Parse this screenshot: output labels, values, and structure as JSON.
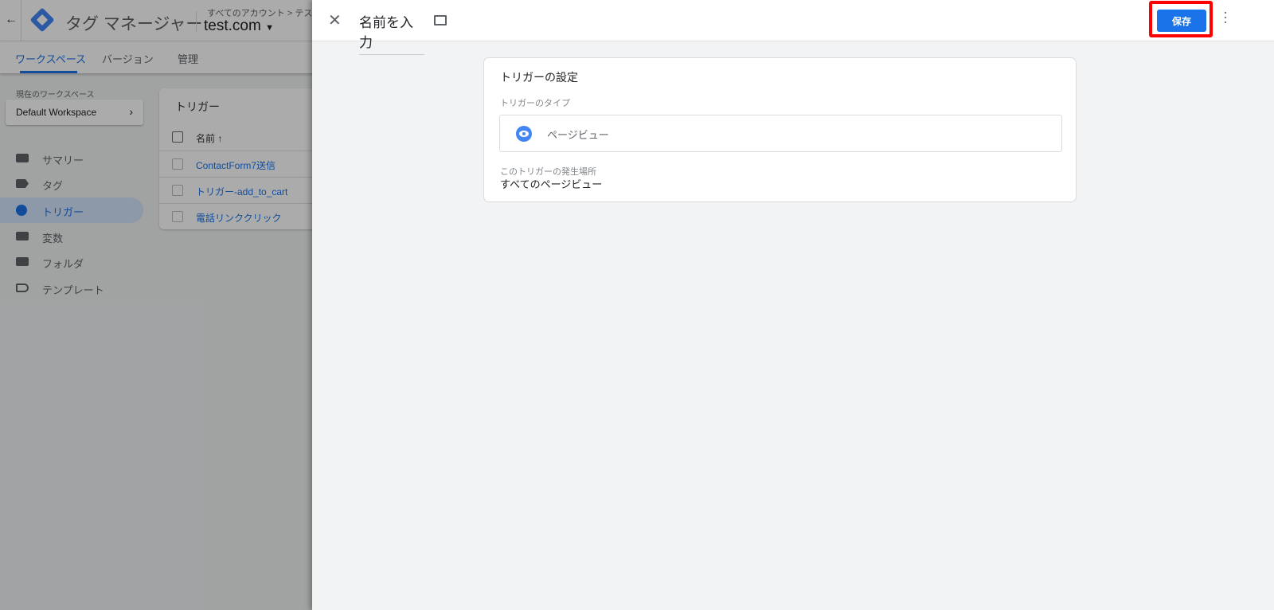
{
  "background": {
    "app_title": "タグ マネージャー",
    "breadcrumb": "すべてのアカウント > テスト",
    "account": "test.com",
    "tabs": [
      "ワークスペース",
      "バージョン",
      "管理"
    ],
    "workspace_label": "現在のワークスペース",
    "workspace": "Default Workspace",
    "nav": [
      {
        "label": "サマリー",
        "icon": "briefcase-icon"
      },
      {
        "label": "タグ",
        "icon": "tag-icon"
      },
      {
        "label": "トリガー",
        "icon": "trigger-icon",
        "active": true
      },
      {
        "label": "変数",
        "icon": "variables-icon"
      },
      {
        "label": "フォルダ",
        "icon": "folder-icon"
      },
      {
        "label": "テンプレート",
        "icon": "template-icon"
      }
    ],
    "list": {
      "title": "トリガー",
      "column": "名前 ↑",
      "rows": [
        "ContactForm7送信",
        "トリガー-add_to_cart",
        "電話リンククリック"
      ]
    }
  },
  "panel": {
    "name_placeholder": "名前を入力",
    "save_label": "保存",
    "card": {
      "title": "トリガーの設定",
      "type_label": "トリガーのタイプ",
      "type_value": "ページビュー",
      "fires_label": "このトリガーの発生場所",
      "fires_value": "すべてのページビュー"
    }
  },
  "colors": {
    "accent": "#1a73e8",
    "highlight": "#ff0000"
  }
}
